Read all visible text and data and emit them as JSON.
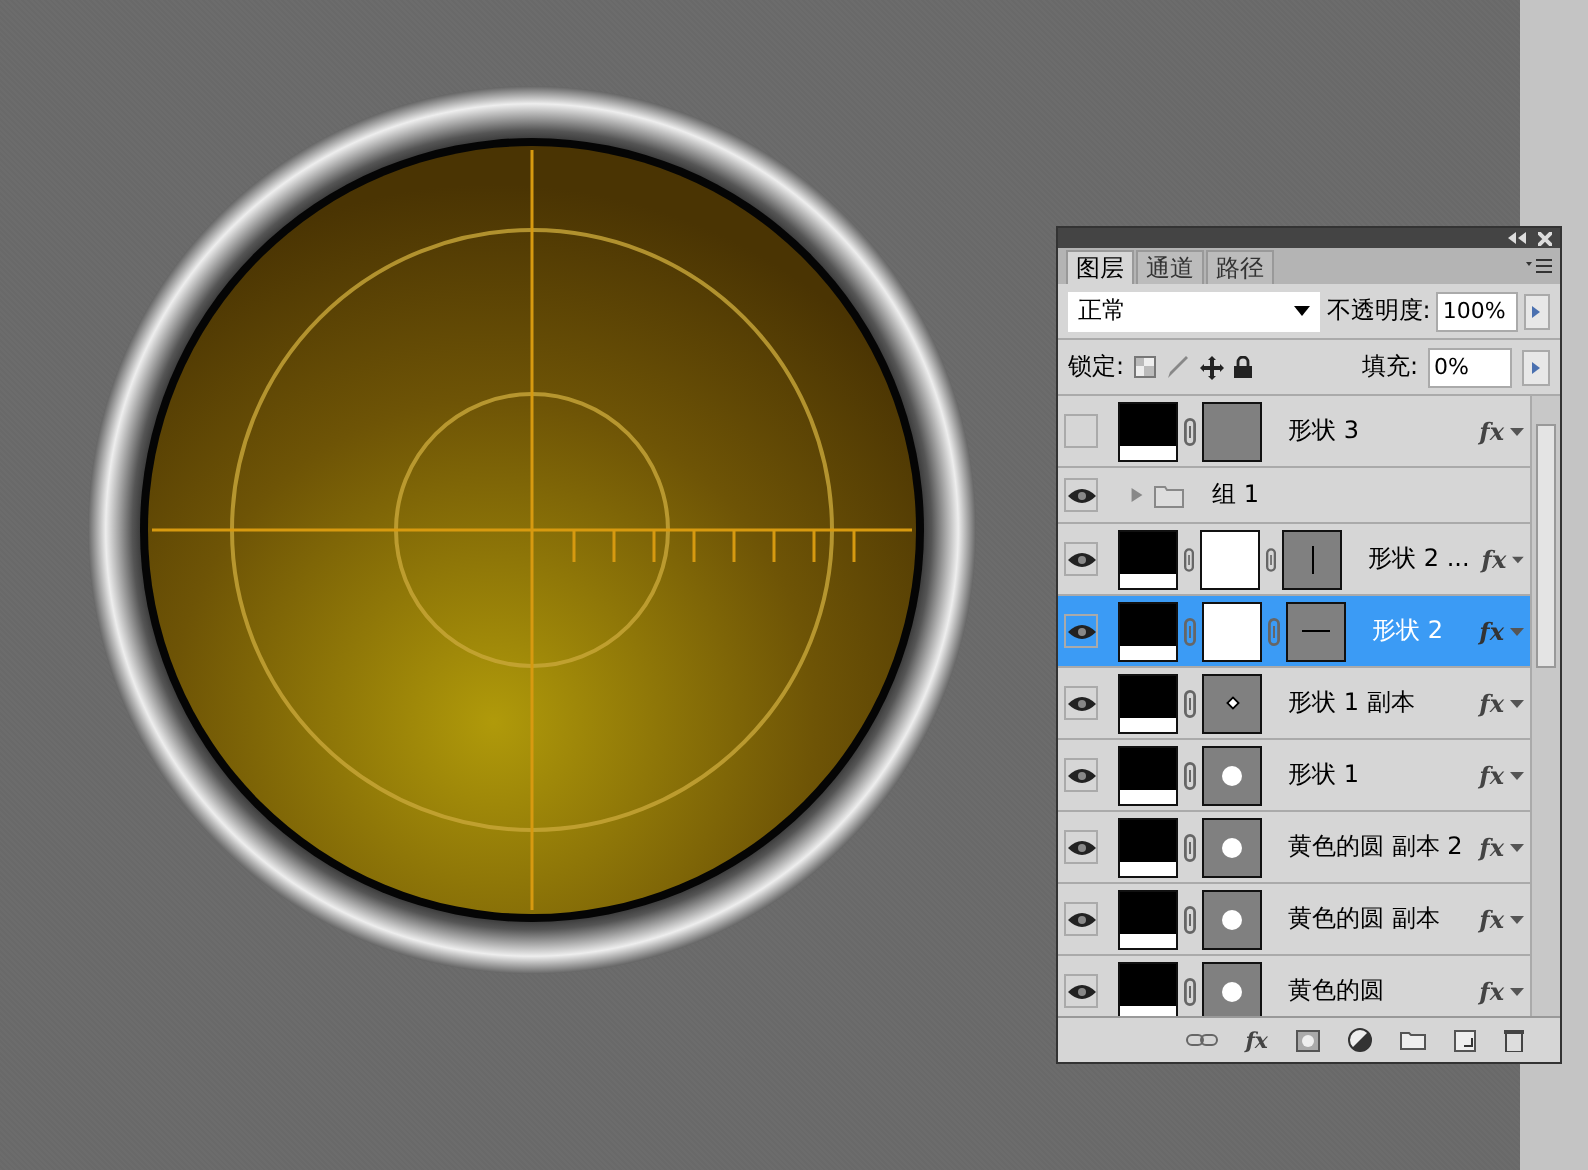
{
  "layers_panel": {
    "tabs": [
      {
        "label": "图层",
        "selected": true
      },
      {
        "label": "通道",
        "selected": false
      },
      {
        "label": "路径",
        "selected": false
      }
    ],
    "style_button": "fx",
    "blend_mode": "正常",
    "opacity_label": "不透明度:",
    "opacity": "100%",
    "lock_label": "锁定:",
    "fill_label": "填充:",
    "fill": "0%",
    "layers": [
      {
        "kind": "layer",
        "name": "形状 3",
        "visible": false,
        "selected": false,
        "mask": false,
        "vector_mask": {
          "kind": "blank"
        },
        "fx": "fx"
      },
      {
        "kind": "group",
        "name": "组 1",
        "visible": true,
        "selected": false,
        "expanded": false
      },
      {
        "kind": "layer",
        "name": "形状 2 ...",
        "visible": true,
        "selected": false,
        "mask": true,
        "vector_mask": {
          "kind": "vline"
        },
        "fx": "fx"
      },
      {
        "kind": "layer",
        "name": "形状 2",
        "visible": true,
        "selected": true,
        "mask": true,
        "vector_mask": {
          "kind": "hline"
        },
        "fx": "fx"
      },
      {
        "kind": "layer",
        "name": "形状 1 副本",
        "visible": true,
        "selected": false,
        "mask": false,
        "vector_mask": {
          "kind": "dot"
        },
        "fx": "fx"
      },
      {
        "kind": "layer",
        "name": "形状 1",
        "visible": true,
        "selected": false,
        "mask": false,
        "vector_mask": {
          "kind": "circle"
        },
        "fx": "fx"
      },
      {
        "kind": "layer",
        "name": "黄色的圆 副本 2",
        "visible": true,
        "selected": false,
        "mask": false,
        "vector_mask": {
          "kind": "circle"
        },
        "fx": "fx"
      },
      {
        "kind": "layer",
        "name": "黄色的圆 副本",
        "visible": true,
        "selected": false,
        "mask": false,
        "vector_mask": {
          "kind": "circle"
        },
        "fx": "fx"
      },
      {
        "kind": "layer",
        "name": "黄色的圆",
        "visible": true,
        "selected": false,
        "mask": false,
        "vector_mask": {
          "kind": "circle"
        },
        "fx": "fx"
      }
    ]
  }
}
